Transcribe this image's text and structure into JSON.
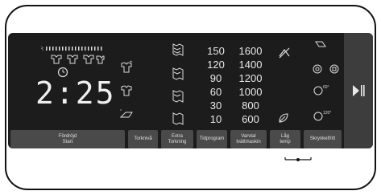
{
  "display": {
    "time": "2:25"
  },
  "temperatures": [
    "150",
    "120",
    "90",
    "60",
    "30",
    "10"
  ],
  "spin_speeds": [
    "1600",
    "1400",
    "1200",
    "1000",
    "800",
    "600"
  ],
  "degree_labels": {
    "sixty": "60°",
    "onetwenty": "120°"
  },
  "buttons": [
    {
      "label": "Fördröjd\nStart"
    },
    {
      "label": "Torknivå"
    },
    {
      "label": "Extra\nTorkning"
    },
    {
      "label": "Tidprogram"
    },
    {
      "label": "Varvtal\ntvättmaskin"
    },
    {
      "label": "Låg\ntemp"
    },
    {
      "label": "Skrynkelfritt"
    }
  ],
  "colors": {
    "panel": "#1c1c1c",
    "button": "#4a4a4a",
    "text": "#e8e8e8"
  },
  "icons": [
    "clock-icon",
    "shirt-icon",
    "iron-icon",
    "leaf-icon",
    "no-spin-icon",
    "play-pause-icon"
  ]
}
